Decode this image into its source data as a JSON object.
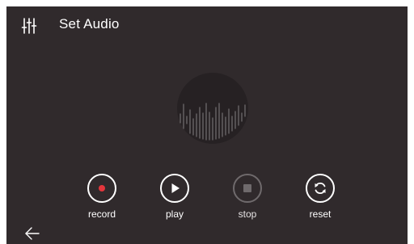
{
  "header": {
    "title": "Set Audio",
    "icon": "equalizer-icon"
  },
  "visualizer": {
    "icon": "audio-waveform-icon"
  },
  "controls": [
    {
      "label": "record",
      "icon": "record-icon",
      "enabled": true
    },
    {
      "label": "play",
      "icon": "play-icon",
      "enabled": true
    },
    {
      "label": "stop",
      "icon": "stop-icon",
      "enabled": false
    },
    {
      "label": "reset",
      "icon": "reset-icon",
      "enabled": true
    }
  ],
  "footer": {
    "back_icon": "back-arrow-icon"
  },
  "colors": {
    "background": "#302a2c",
    "record_dot": "#e4363c",
    "disabled": "#6f6a6c"
  }
}
